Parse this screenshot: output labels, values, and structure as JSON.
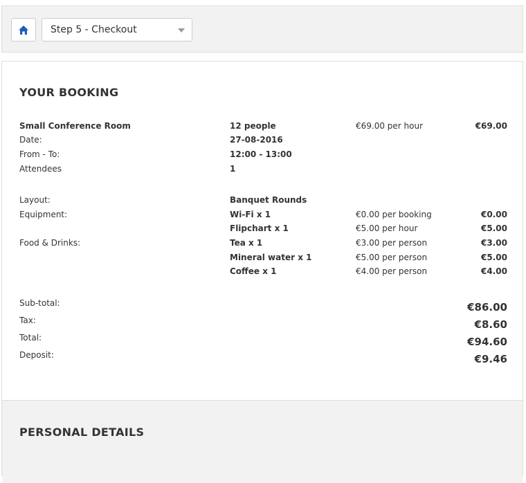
{
  "nav": {
    "home_icon": "home-icon",
    "step_select": {
      "value": "Step 5 - Checkout"
    }
  },
  "booking": {
    "title": "YOUR BOOKING",
    "room": {
      "name": "Small Conference Room",
      "capacity": "12 people",
      "rate": "€69.00 per hour",
      "price": "€69.00"
    },
    "date": {
      "label": "Date:",
      "value": "27-08-2016"
    },
    "time": {
      "label": "From - To:",
      "value": "12:00 - 13:00"
    },
    "attendees": {
      "label": "Attendees",
      "value": "1"
    },
    "layout": {
      "label": "Layout:",
      "value": "Banquet Rounds"
    },
    "equipment": {
      "label": "Equipment:",
      "items": [
        {
          "name": "Wi-Fi x 1",
          "rate": "€0.00 per booking",
          "price": "€0.00"
        },
        {
          "name": "Flipchart x 1",
          "rate": "€5.00 per hour",
          "price": "€5.00"
        }
      ]
    },
    "food": {
      "label": "Food & Drinks:",
      "items": [
        {
          "name": "Tea x 1",
          "rate": "€3.00 per person",
          "price": "€3.00"
        },
        {
          "name": "Mineral water x 1",
          "rate": "€5.00 per person",
          "price": "€5.00"
        },
        {
          "name": "Coffee x 1",
          "rate": "€4.00 per person",
          "price": "€4.00"
        }
      ]
    },
    "totals": {
      "subtotal": {
        "label": "Sub-total:",
        "value": "€86.00"
      },
      "tax": {
        "label": "Tax:",
        "value": "€8.60"
      },
      "total": {
        "label": "Total:",
        "value": "€94.60"
      },
      "deposit": {
        "label": "Deposit:",
        "value": "€9.46"
      }
    }
  },
  "personal": {
    "title": "PERSONAL DETAILS"
  },
  "colors": {
    "accent": "#1a5fb4",
    "panel": "#f2f2f2",
    "border": "#dddddd"
  }
}
